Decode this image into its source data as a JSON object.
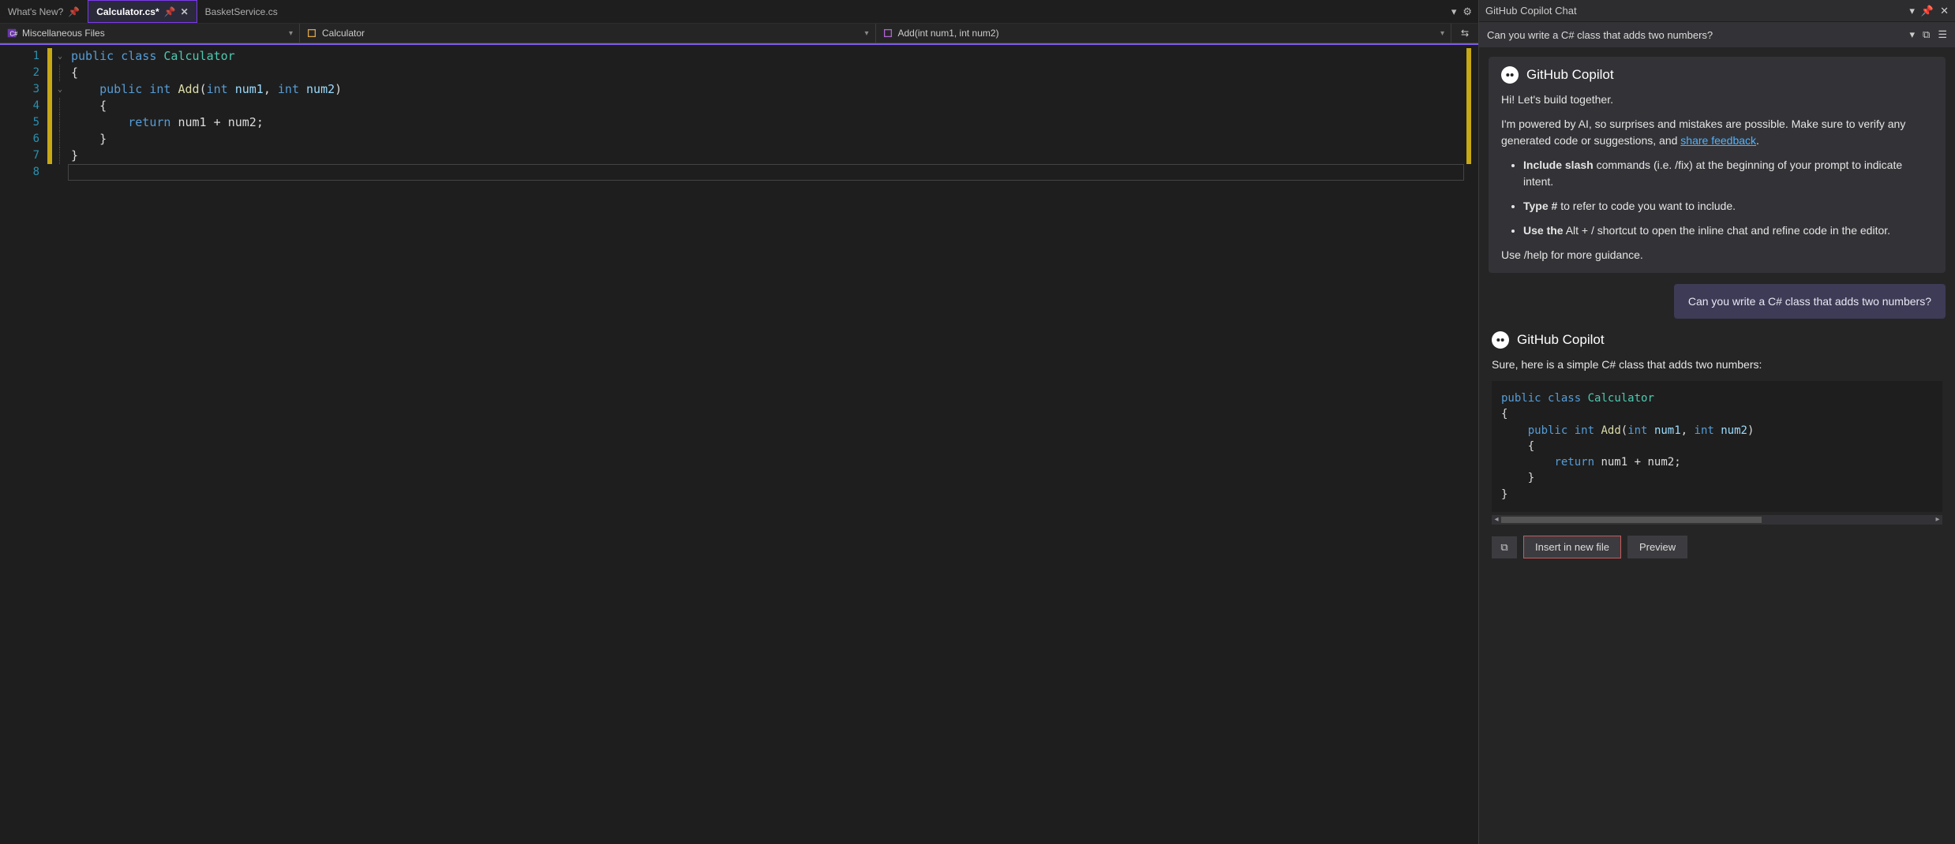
{
  "tabs": {
    "whats_new": "What's New?",
    "whats_new_pin_label": "pin",
    "active": "Calculator.cs*",
    "basket": "BasketService.cs"
  },
  "toolbar_right": {
    "dropdown_glyph": "▾",
    "gear_glyph": "⚙"
  },
  "navbar": {
    "project": "Miscellaneous Files",
    "class_label": "Calculator",
    "method_label": "Add(int num1, int num2)"
  },
  "line_numbers": [
    "1",
    "2",
    "3",
    "4",
    "5",
    "6",
    "7",
    "8"
  ],
  "code": {
    "l1": {
      "a": "public",
      "b": "class",
      "c": "Calculator"
    },
    "l2": "{",
    "l3": {
      "a": "public",
      "b": "int",
      "c": "Add",
      "d": "int",
      "e": "num1",
      "f": "int",
      "g": "num2"
    },
    "l4": "    {",
    "l5": {
      "a": "return",
      "b": "num1",
      "c": "+",
      "d": "num2",
      "e": ";"
    },
    "l6": "    }",
    "l7": "}"
  },
  "copilot": {
    "panel_title": "GitHub Copilot Chat",
    "input_text": "Can you write a C# class that adds two numbers?",
    "title": "GitHub Copilot",
    "intro_greeting": "Hi! Let's build together.",
    "intro_powered": "I'm powered by AI, so surprises and mistakes are possible. Make sure to verify any generated code or suggestions, and ",
    "share_feedback": "share feedback",
    "period": ".",
    "bullet1_strong": "Include slash",
    "bullet1_rest": " commands (i.e. /fix) at the beginning of your prompt to indicate intent.",
    "bullet2_strong": "Type #",
    "bullet2_rest": " to refer to code you want to include.",
    "bullet3_strong": "Use the",
    "bullet3_rest": " Alt + / shortcut to open the inline chat and refine code in the editor.",
    "help_line": "Use /help for more guidance.",
    "user_message": "Can you write a C# class that adds two numbers?",
    "answer_intro": "Sure, here is a simple C# class that adds two numbers:",
    "answer_code": {
      "l1a": "public",
      "l1b": "class",
      "l1c": "Calculator",
      "l2": "{",
      "l3a": "public",
      "l3b": "int",
      "l3c": "Add",
      "l3d": "int",
      "l3e": "num1",
      "l3f": "int",
      "l3g": "num2",
      "l4": "    {",
      "l5a": "return",
      "l5b": "num1",
      "l5c": "+",
      "l5d": "num2",
      "l5e": ";",
      "l6": "    }",
      "l7": "}"
    },
    "actions": {
      "insert": "Insert in new file",
      "preview": "Preview"
    }
  }
}
